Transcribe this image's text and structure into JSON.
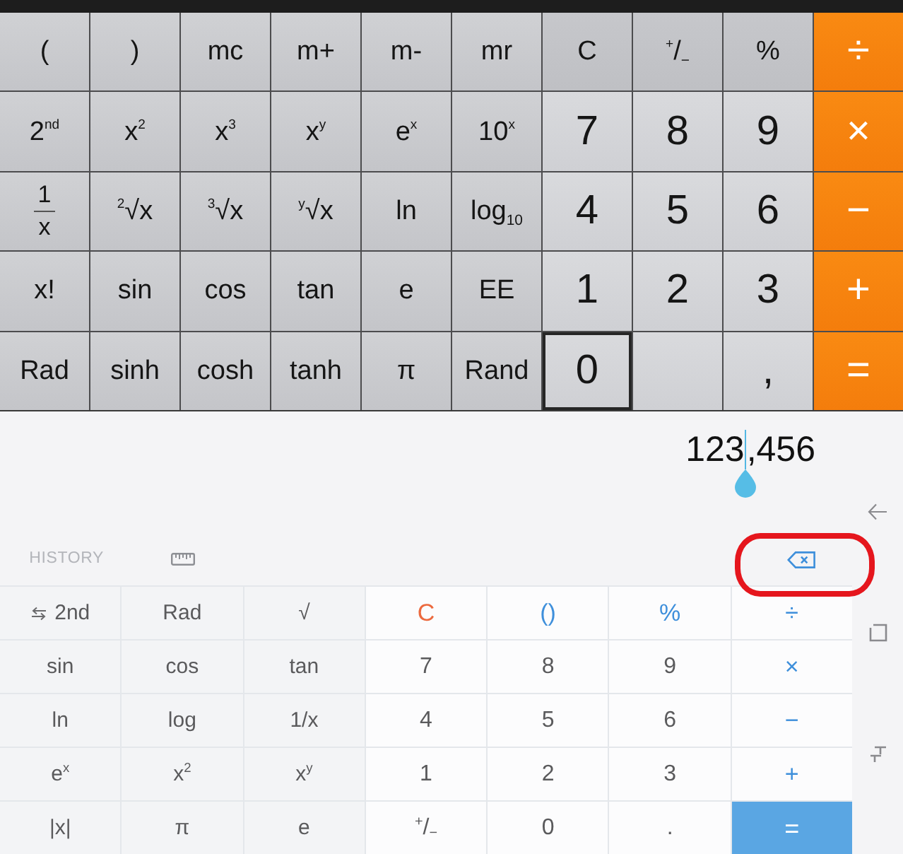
{
  "scientific_keypad": {
    "rows": [
      [
        {
          "label": "(",
          "kind": "sci",
          "outlined": false
        },
        {
          "label": ")",
          "kind": "sci",
          "outlined": false
        },
        {
          "label": "mc",
          "kind": "sci",
          "outlined": false
        },
        {
          "label": "m+",
          "kind": "sci",
          "outlined": false
        },
        {
          "label": "m-",
          "kind": "sci",
          "outlined": false
        },
        {
          "label": "mr",
          "kind": "sci",
          "outlined": false
        },
        {
          "label": "C",
          "kind": "func",
          "outlined": false
        },
        {
          "label": "$^{+}$/$_{−}$",
          "kind": "func",
          "outlined": false
        },
        {
          "label": "%",
          "kind": "func",
          "outlined": false
        },
        {
          "label": "÷",
          "kind": "op",
          "outlined": false
        }
      ],
      [
        {
          "label": "2$^{nd}$",
          "kind": "sci",
          "outlined": false
        },
        {
          "label": "x$^{2}$",
          "kind": "sci",
          "outlined": false
        },
        {
          "label": "x$^{3}$",
          "kind": "sci",
          "outlined": false
        },
        {
          "label": "x$^{y}$",
          "kind": "sci",
          "outlined": false
        },
        {
          "label": "e$^{x}$",
          "kind": "sci",
          "outlined": false
        },
        {
          "label": "10$^{x}$",
          "kind": "sci",
          "outlined": false
        },
        {
          "label": "7",
          "kind": "digit",
          "outlined": false
        },
        {
          "label": "8",
          "kind": "digit",
          "outlined": false
        },
        {
          "label": "9",
          "kind": "digit",
          "outlined": false
        },
        {
          "label": "×",
          "kind": "op",
          "outlined": false
        }
      ],
      [
        {
          "numerator": "1",
          "denominator": "x",
          "kind": "fraction",
          "outlined": false
        },
        {
          "label": "$^{2}$√x",
          "kind": "sci",
          "outlined": false
        },
        {
          "label": "$^{3}$√x",
          "kind": "sci",
          "outlined": false
        },
        {
          "label": "$^{y}$√x",
          "kind": "sci",
          "outlined": false
        },
        {
          "label": "ln",
          "kind": "sci",
          "outlined": false
        },
        {
          "label": "log$_{10}$",
          "kind": "sci",
          "outlined": false
        },
        {
          "label": "4",
          "kind": "digit",
          "outlined": false
        },
        {
          "label": "5",
          "kind": "digit",
          "outlined": false
        },
        {
          "label": "6",
          "kind": "digit",
          "outlined": false
        },
        {
          "label": "−",
          "kind": "op",
          "outlined": false
        }
      ],
      [
        {
          "label": "x!",
          "kind": "sci",
          "outlined": false
        },
        {
          "label": "sin",
          "kind": "sci",
          "outlined": false
        },
        {
          "label": "cos",
          "kind": "sci",
          "outlined": false
        },
        {
          "label": "tan",
          "kind": "sci",
          "outlined": false
        },
        {
          "label": "e",
          "kind": "sci",
          "outlined": false
        },
        {
          "label": "EE",
          "kind": "sci",
          "outlined": false
        },
        {
          "label": "1",
          "kind": "digit",
          "outlined": false
        },
        {
          "label": "2",
          "kind": "digit",
          "outlined": false
        },
        {
          "label": "3",
          "kind": "digit",
          "outlined": false
        },
        {
          "label": "+",
          "kind": "op",
          "outlined": false
        }
      ],
      [
        {
          "label": "Rad",
          "kind": "sci",
          "outlined": false
        },
        {
          "label": "sinh",
          "kind": "sci",
          "outlined": false
        },
        {
          "label": "cosh",
          "kind": "sci",
          "outlined": false
        },
        {
          "label": "tanh",
          "kind": "sci",
          "outlined": false
        },
        {
          "label": "π",
          "kind": "sci",
          "outlined": false
        },
        {
          "label": "Rand",
          "kind": "sci",
          "outlined": false
        },
        {
          "label": "0",
          "kind": "digit",
          "outlined": true
        },
        {
          "kind": "blank",
          "outlined": false
        },
        {
          "label": ",",
          "kind": "digit",
          "outlined": false
        },
        {
          "label": "=",
          "kind": "op",
          "outlined": false
        }
      ]
    ]
  },
  "display": {
    "value_before_cursor": "123",
    "value_after_cursor": ",456"
  },
  "toolbar": {
    "history": "HISTORY",
    "backspace_highlighted": true
  },
  "keypad": {
    "rows": [
      [
        {
          "label": "2nd",
          "kind": "second"
        },
        {
          "label": "Rad",
          "kind": "sci"
        },
        {
          "label": "√",
          "kind": "sci"
        },
        {
          "label": "C",
          "kind": "clear"
        },
        {
          "label": "()",
          "kind": "op"
        },
        {
          "label": "%",
          "kind": "op"
        },
        {
          "label": "÷",
          "kind": "op"
        }
      ],
      [
        {
          "label": "sin",
          "kind": "sci"
        },
        {
          "label": "cos",
          "kind": "sci"
        },
        {
          "label": "tan",
          "kind": "sci"
        },
        {
          "label": "7",
          "kind": "digit"
        },
        {
          "label": "8",
          "kind": "digit"
        },
        {
          "label": "9",
          "kind": "digit"
        },
        {
          "label": "×",
          "kind": "op"
        }
      ],
      [
        {
          "label": "ln",
          "kind": "sci"
        },
        {
          "label": "log",
          "kind": "sci"
        },
        {
          "label": "1/x",
          "kind": "sci"
        },
        {
          "label": "4",
          "kind": "digit"
        },
        {
          "label": "5",
          "kind": "digit"
        },
        {
          "label": "6",
          "kind": "digit"
        },
        {
          "label": "−",
          "kind": "op"
        }
      ],
      [
        {
          "label": "e$^{x}$",
          "kind": "sci"
        },
        {
          "label": "x$^{2}$",
          "kind": "sci"
        },
        {
          "label": "x$^{y}$",
          "kind": "sci"
        },
        {
          "label": "1",
          "kind": "digit"
        },
        {
          "label": "2",
          "kind": "digit"
        },
        {
          "label": "3",
          "kind": "digit"
        },
        {
          "label": "+",
          "kind": "op"
        }
      ],
      [
        {
          "label": "|x|",
          "kind": "sci"
        },
        {
          "label": "π",
          "kind": "sci"
        },
        {
          "label": "e",
          "kind": "sci"
        },
        {
          "label": "$^{+}$/$_{−}$",
          "kind": "digit"
        },
        {
          "label": "0",
          "kind": "digit"
        },
        {
          "label": ".",
          "kind": "digit"
        },
        {
          "label": "=",
          "kind": "equals"
        }
      ]
    ]
  }
}
